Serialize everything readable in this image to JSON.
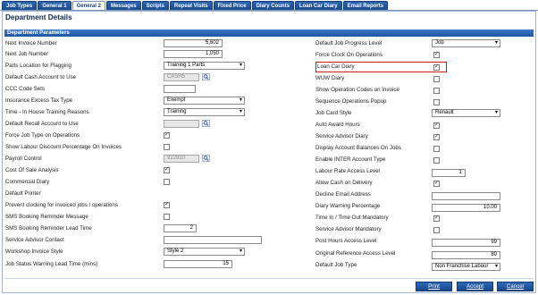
{
  "tabs": [
    {
      "label": "Job Types",
      "active": false
    },
    {
      "label": "General 1",
      "active": false
    },
    {
      "label": "General 2",
      "active": true
    },
    {
      "label": "Messages",
      "active": false
    },
    {
      "label": "Scripts",
      "active": false
    },
    {
      "label": "Repeat Visits",
      "active": false
    },
    {
      "label": "Fixed Price",
      "active": false
    },
    {
      "label": "Diary Counts",
      "active": false
    },
    {
      "label": "Loan Car Diary",
      "active": false
    },
    {
      "label": "Email Reports",
      "active": false
    }
  ],
  "page_title": "Department Details",
  "section_title": "Department Parameters",
  "left": {
    "next_invoice_number": {
      "label": "Next Invoice Number",
      "value": "5,602"
    },
    "next_job_number": {
      "label": "Next Job Number",
      "value": "1,050"
    },
    "parts_location": {
      "label": "Parts Location for Flagging",
      "value": "Training 1 Parts"
    },
    "default_cash_account": {
      "label": "Default Cash Account to Use",
      "value": "CASH5"
    },
    "ccc_code_sets": {
      "label": "CCC Code Sets",
      "value": ""
    },
    "insurance_excess_tax": {
      "label": "Insurance Excess Tax Type",
      "value": "Exempt"
    },
    "time_inhouse_training": {
      "label": "Time - In House Training Reasons",
      "value": "Training"
    },
    "default_recall_account": {
      "label": "Default Recall Account to Use",
      "value": ""
    },
    "force_job_type": {
      "label": "Force Job Type on Operations",
      "checked": true
    },
    "show_labour_discount": {
      "label": "Show Labour Discount Percentage On Invoices",
      "checked": false
    },
    "payroll_control": {
      "label": "Payroll Control",
      "value": "922910"
    },
    "cost_of_sale": {
      "label": "Cost Of Sale Analysis",
      "checked": true
    },
    "commercial_diary": {
      "label": "Commercial Diary",
      "checked": false
    },
    "default_printer": {
      "label": "Default Printer",
      "value": ""
    },
    "prevent_clocking": {
      "label": "Prevent clocking for invoiced jobs / operations",
      "checked": true
    },
    "sms_booking_msg": {
      "label": "SMS Booking Reminder Message",
      "checked": false
    },
    "sms_booking_lead": {
      "label": "SMS Booking Reminder Lead Time",
      "value": "2"
    },
    "service_advisor_contact": {
      "label": "Service Advisor Contact",
      "value": ""
    },
    "workshop_invoice_style": {
      "label": "Workshop Invoice Style",
      "value": "Style 2"
    },
    "job_status_warning": {
      "label": "Job Status Warning Lead Time (mins)",
      "value": "15"
    }
  },
  "right": {
    "default_job_progress": {
      "label": "Default Job Progress Level",
      "value": "Job"
    },
    "force_clock_on": {
      "label": "Force Clock On Operations",
      "checked": true
    },
    "loan_car_diary": {
      "label": "Loan Car Diary",
      "checked": true
    },
    "wuw_diary": {
      "label": "WUW Diary",
      "checked": false
    },
    "show_op_codes": {
      "label": "Show Operation Codes on Invoice",
      "checked": false
    },
    "sequence_ops_popup": {
      "label": "Sequence Operations Popup",
      "checked": false
    },
    "job_card_style": {
      "label": "Job Card Style",
      "value": "Renault"
    },
    "auto_award_hours": {
      "label": "Auto Award Hours",
      "checked": true
    },
    "service_advisor_diary": {
      "label": "Service Advisor Diary",
      "checked": true
    },
    "display_account_balances": {
      "label": "Display Account Balances On Jobs",
      "checked": false
    },
    "enable_inter_account": {
      "label": "Enable INTER Account Type",
      "checked": false
    },
    "labour_rate_access": {
      "label": "Labour Rate Access Level",
      "value": "1"
    },
    "allow_cash_delivery": {
      "label": "Allow Cash on Delivery",
      "checked": true
    },
    "decline_email": {
      "label": "Decline Email Address",
      "value": ""
    },
    "diary_warning_pct": {
      "label": "Diary Warning Percentage",
      "value": "10.00"
    },
    "time_in_out_mandatory": {
      "label": "Time In / Time Out Mandatory",
      "checked": true
    },
    "service_advisor_mandatory": {
      "label": "Service Advisor Mandatory",
      "checked": false
    },
    "post_hours_access": {
      "label": "Post Hours Access Level",
      "value": "99"
    },
    "original_ref_access": {
      "label": "Original Reference Access Level",
      "value": "80"
    },
    "default_job_type": {
      "label": "Default Job Type",
      "value": "Non Franchise Labour"
    }
  },
  "buttons": {
    "print": "Print",
    "accept": "Accept",
    "cancel": "Cancel"
  },
  "icons": {
    "lookup": "lookup-icon",
    "checkmark": "✓",
    "dropdown": "▾"
  }
}
